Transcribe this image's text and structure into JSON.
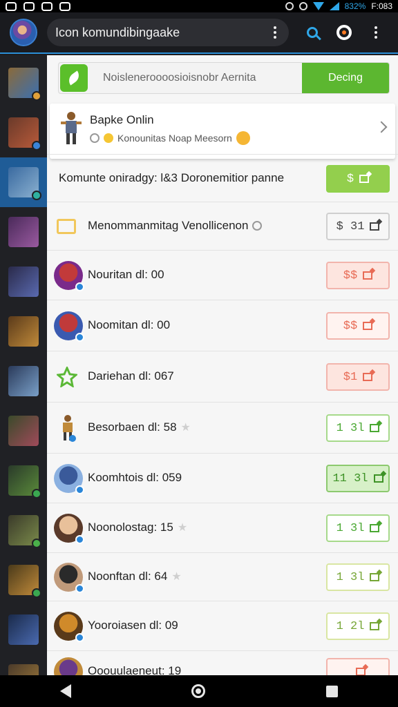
{
  "status": {
    "time": "F:083",
    "battery": "832%"
  },
  "appbar": {
    "search_text": "Icon komundibingaake"
  },
  "sidebar": {
    "items": [
      {
        "colors": [
          "#8a6a3a",
          "#3b6fb0"
        ],
        "badge": "#e0a03a"
      },
      {
        "colors": [
          "#6a3a2a",
          "#b85a3a"
        ],
        "badge": "#3a84d8"
      },
      {
        "colors": [
          "#3a6aa0",
          "#8ab0d0"
        ],
        "badge": "#2fb0a0",
        "active": true
      },
      {
        "colors": [
          "#4a2a5a",
          "#9a5aa0"
        ],
        "badge": ""
      },
      {
        "colors": [
          "#2a2a4a",
          "#5a6ab0"
        ],
        "badge": ""
      },
      {
        "colors": [
          "#5a3a1a",
          "#c08a3a"
        ],
        "badge": ""
      },
      {
        "colors": [
          "#2a3a5a",
          "#7aa0c8"
        ],
        "badge": ""
      },
      {
        "colors": [
          "#3a4a2a",
          "#a04a5a"
        ],
        "badge": ""
      },
      {
        "colors": [
          "#2a3a2a",
          "#5a8a3a"
        ],
        "badge": "#3aa850"
      },
      {
        "colors": [
          "#3a3a2a",
          "#7a8a4a"
        ],
        "badge": "#4ab04a"
      },
      {
        "colors": [
          "#4a3a1a",
          "#c08a3a"
        ],
        "badge": "#3aa850"
      },
      {
        "colors": [
          "#1a2a4a",
          "#4a6ab0"
        ],
        "badge": ""
      },
      {
        "colors": [
          "#4a3a2a",
          "#a07a3a"
        ],
        "badge": ""
      }
    ]
  },
  "promo": {
    "text": "Noisleneroooosioisnobr Aernita",
    "button": "Decing"
  },
  "feature": {
    "title": "Bapke Onlin",
    "subtitle": "Konounitas Noap Meesorn"
  },
  "rows": [
    {
      "text": "Komunte oniradgy: l&3 Doronemitior panne",
      "price": "$",
      "style": "p-lime",
      "kind": "none"
    },
    {
      "text": "Menommanmitag Venollicenon",
      "price": "$ 31",
      "style": "p-gray",
      "kind": "folder"
    },
    {
      "text": "Nouritan dl: 00",
      "price": "$$",
      "style": "p-red-fill",
      "kind": "avatar",
      "avatar": [
        "#c23a3a",
        "#7a2a8a"
      ]
    },
    {
      "text": "Noomitan dl: 00",
      "price": "$$",
      "style": "p-red",
      "kind": "avatar",
      "avatar": [
        "#c03a3a",
        "#3a5ab0"
      ]
    },
    {
      "text": "Dariehan dl: 067",
      "price": "$1",
      "style": "p-red-fill",
      "kind": "arrow"
    },
    {
      "text": "Besorbaen dl: 58",
      "price": "1 3l",
      "style": "p-green",
      "kind": "figure"
    },
    {
      "text": "Koomhtois dl: 059",
      "price": "11 3l",
      "style": "p-green-fill",
      "kind": "avatar",
      "avatar": [
        "#3a5a9a",
        "#8ab0e0"
      ]
    },
    {
      "text": "Noonolostag: 15",
      "price": "1 3l",
      "style": "p-green",
      "kind": "avatar",
      "avatar": [
        "#e8c09a",
        "#5a3a2a"
      ]
    },
    {
      "text": "Noonftan dl: 64",
      "price": "1 3l",
      "style": "p-yellow",
      "kind": "avatar",
      "avatar": [
        "#2a2a2a",
        "#c09a7a"
      ]
    },
    {
      "text": "Yooroiasen dl: 09",
      "price": "1 2l",
      "style": "p-yellow",
      "kind": "avatar",
      "avatar": [
        "#d08a2a",
        "#5a3a1a"
      ]
    },
    {
      "text": "Ooouulaeneut: 19",
      "price": "",
      "style": "p-red",
      "kind": "avatar",
      "avatar": [
        "#6a3a8a",
        "#c08a3a"
      ]
    }
  ]
}
